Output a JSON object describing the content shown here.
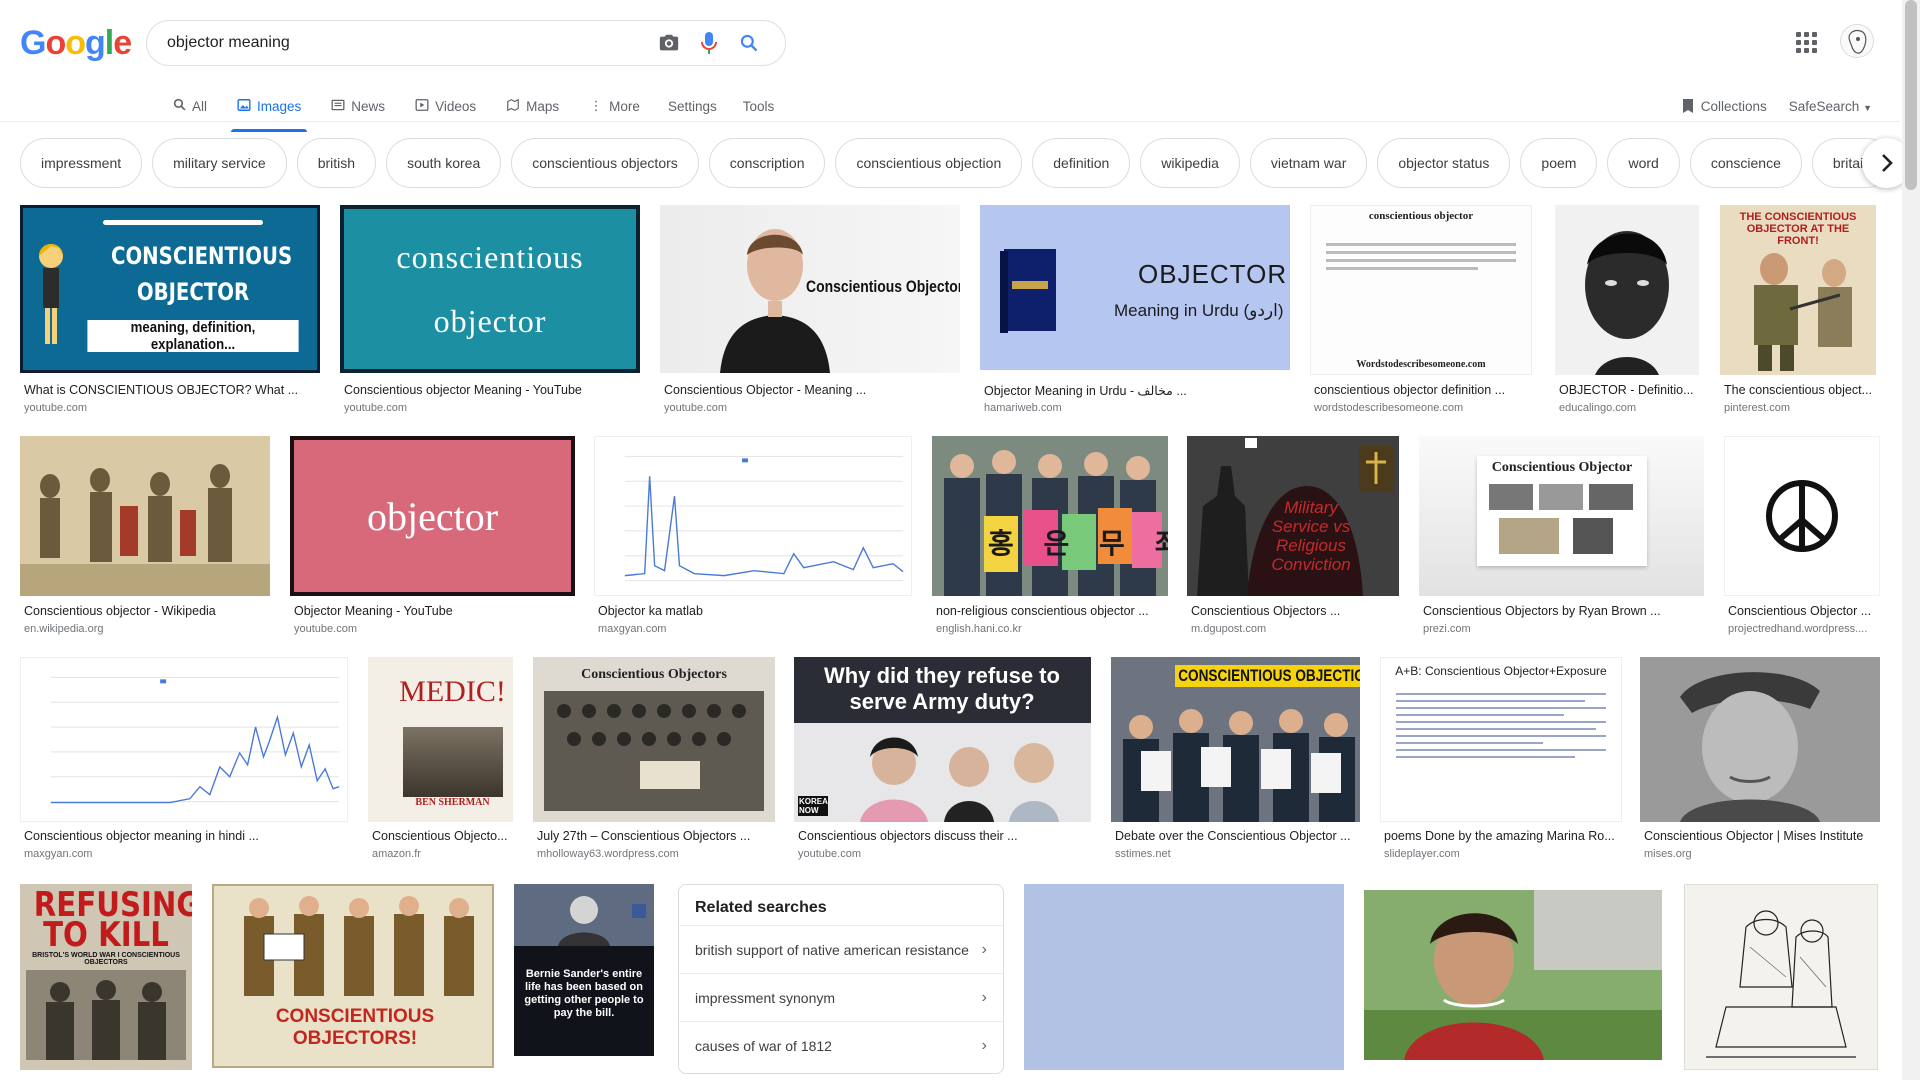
{
  "logo": {
    "text": "Google"
  },
  "search": {
    "value": "objector meaning"
  },
  "tabs": [
    {
      "label": "All",
      "icon": "search-icon"
    },
    {
      "label": "Images",
      "icon": "image-icon"
    },
    {
      "label": "News",
      "icon": "news-icon"
    },
    {
      "label": "Videos",
      "icon": "video-icon"
    },
    {
      "label": "Maps",
      "icon": "map-icon"
    },
    {
      "label": "More",
      "icon": "more-icon"
    }
  ],
  "tools": {
    "settings": "Settings",
    "tools": "Tools"
  },
  "right": {
    "collections": "Collections",
    "safesearch": "SafeSearch"
  },
  "chips": [
    "impressment",
    "military service",
    "british",
    "south korea",
    "conscientious objectors",
    "conscription",
    "conscientious objection",
    "definition",
    "wikipedia",
    "vietnam war",
    "objector status",
    "poem",
    "word",
    "conscience",
    "britain"
  ],
  "results": [
    {
      "caption": "What is CONSCIENTIOUS OBJECTOR? What ...",
      "source": "youtube.com",
      "img_text": "CONSCIENTIOUS OBJECTOR",
      "img_sub": "meaning, definition, explanation..."
    },
    {
      "caption": "Conscientious objector Meaning - YouTube",
      "source": "youtube.com",
      "img_text": "conscientious objector"
    },
    {
      "caption": "Conscientious Objector - Meaning ...",
      "source": "youtube.com",
      "img_text": "Conscientious Objector"
    },
    {
      "caption": "Objector Meaning in Urdu - مخالف ...",
      "source": "hamariweb.com",
      "img_text": "OBJECTOR",
      "img_sub": "Meaning in Urdu (اردو)"
    },
    {
      "caption": "conscientious objector definition ...",
      "source": "wordstodescribesomeone.com",
      "img_text": "conscientious objector",
      "img_sub": "Wordstodescribesomeone.com"
    },
    {
      "caption": "OBJECTOR - Definitio...",
      "source": "educalingo.com"
    },
    {
      "caption": "The conscientious object...",
      "source": "pinterest.com",
      "img_text": "THE CONSCIENTIOUS OBJECTOR AT THE FRONT!"
    },
    {
      "caption": "Conscientious objector - Wikipedia",
      "source": "en.wikipedia.org"
    },
    {
      "caption": "Objector Meaning - YouTube",
      "source": "youtube.com",
      "img_text": "objector"
    },
    {
      "caption": "Objector ka matlab",
      "source": "maxgyan.com"
    },
    {
      "caption": "non-religious conscientious objector ...",
      "source": "english.hani.co.kr",
      "img_text": "홍 은 무 죄 다"
    },
    {
      "caption": "Conscientious Objectors ...",
      "source": "m.dgupost.com",
      "img_text": "Military Service vs Religious Conviction"
    },
    {
      "caption": "Conscientious Objectors by Ryan Brown ...",
      "source": "prezi.com",
      "img_text": "Conscientious Objector"
    },
    {
      "caption": "Conscientious Objector ...",
      "source": "projectredhand.wordpress...."
    },
    {
      "caption": "Conscientious objector meaning in hindi ...",
      "source": "maxgyan.com"
    },
    {
      "caption": "Conscientious Objecto...",
      "source": "amazon.fr",
      "img_text": "MEDIC!",
      "img_sub": "BEN SHERMAN"
    },
    {
      "caption": "July 27th – Conscientious Objectors ...",
      "source": "mholloway63.wordpress.com",
      "img_text": "Conscientious Objectors"
    },
    {
      "caption": "Conscientious objectors discuss their ...",
      "source": "youtube.com",
      "img_text": "Why did they refuse to serve Army duty?",
      "img_sub": "KOREA NOW"
    },
    {
      "caption": "Debate over the Conscientious Objector ...",
      "source": "sstimes.net",
      "img_text": "CONSCIENTIOUS OBJECTIO"
    },
    {
      "caption": "poems Done by the amazing Marina Ro...",
      "source": "slideplayer.com",
      "img_text": "A+B: Conscientious Objector+Exposure"
    },
    {
      "caption": "Conscientious Objector | Mises Institute",
      "source": "mises.org"
    },
    {
      "img_text": "REFUSING TO KILL",
      "img_sub": "BRISTOL'S WORLD WAR I CONSCIENTIOUS OBJECTORS"
    },
    {
      "img_text": "CONSCIENTIOUS OBJECTORS!"
    },
    {
      "img_text": "Bernie Sander's entire life has been based on getting other people to pay the bill."
    },
    {},
    {},
    {}
  ],
  "related": {
    "title": "Related searches",
    "items": [
      "british support of native american resistance",
      "impressment synonym",
      "causes of war of 1812"
    ]
  },
  "colors": {
    "accent": "#1a73e8",
    "caption_text": "#202124",
    "source_text": "#70757a"
  }
}
